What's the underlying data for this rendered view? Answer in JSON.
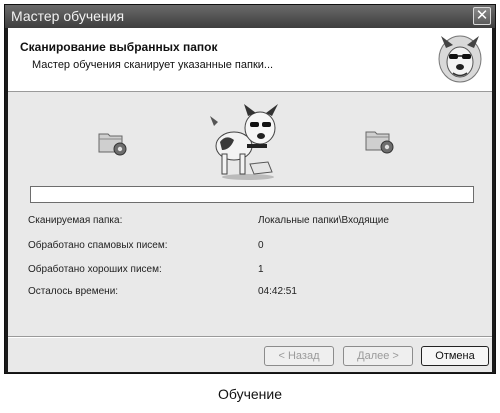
{
  "window": {
    "title": "Мастер обучения",
    "close_icon": "close-icon"
  },
  "header": {
    "title": "Сканирование выбранных папок",
    "subtitle": "Мастер обучения сканирует указанные папки...",
    "icon": "dog-logo-icon"
  },
  "animation": {
    "source_icon": "folder-gear-icon",
    "target_icon": "folder-gear-icon",
    "mascot_icon": "dog-mascot-icon"
  },
  "progress": {
    "value": 0
  },
  "details": [
    {
      "label": "Сканируемая папка:",
      "value": "Локальные папки\\Входящие"
    },
    {
      "label": "Обработано спамовых писем:",
      "value": "0"
    },
    {
      "label": "Обработано хороших писем:",
      "value": "1"
    },
    {
      "label": "Осталось времени:",
      "value": "04:42:51"
    }
  ],
  "buttons": {
    "back": "< Назад",
    "next": "Далее >",
    "cancel": "Отмена"
  },
  "caption": "Обучение"
}
